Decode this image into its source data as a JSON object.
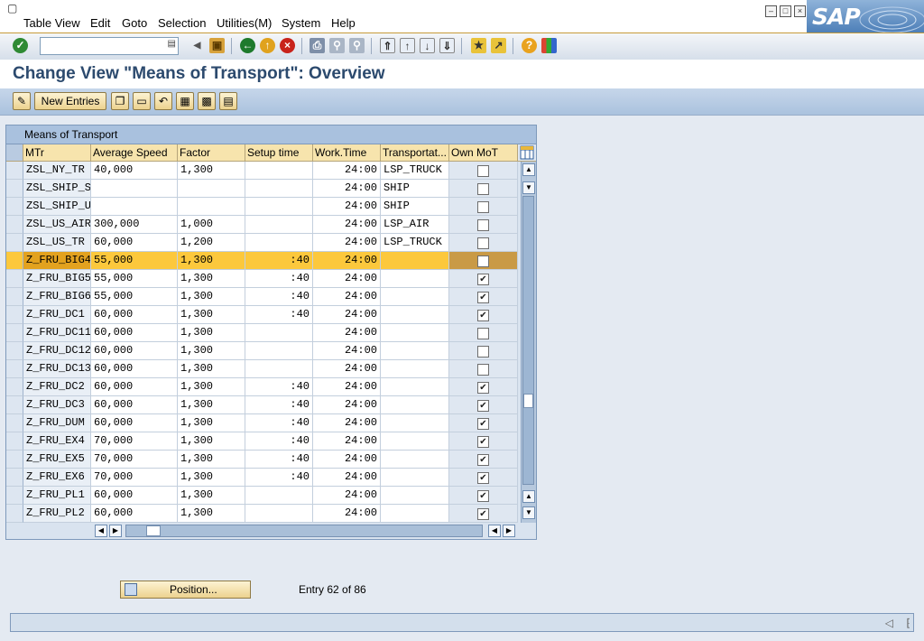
{
  "menubar": {
    "items": [
      {
        "label": "Table View"
      },
      {
        "label": "Edit"
      },
      {
        "label": "Goto"
      },
      {
        "label": "Selection"
      },
      {
        "label": "Utilities(M)"
      },
      {
        "label": "System"
      },
      {
        "label": "Help"
      }
    ],
    "logo": "SAP"
  },
  "toolbar": {
    "command_field": {
      "value": "",
      "placeholder": ""
    },
    "icons": [
      "enter-icon",
      "back-nav-icon",
      "save-icon",
      "back-icon",
      "exit-icon",
      "cancel-icon",
      "print-icon",
      "find-icon",
      "find-next-icon",
      "first-page-icon",
      "previous-page-icon",
      "next-page-icon",
      "last-page-icon",
      "create-session-icon",
      "shortcut-icon",
      "help-icon",
      "customize-layout-icon"
    ]
  },
  "page": {
    "title": "Change View \"Means of Transport\": Overview"
  },
  "app_toolbar": {
    "new_entries_label": "New Entries"
  },
  "table": {
    "title": "Means of Transport",
    "columns": [
      "MTr",
      "Average Speed",
      "Factor",
      "Setup time",
      "Work.Time",
      "Transportat...",
      "Own MoT"
    ],
    "rows": [
      {
        "mtr": "ZSL_NY_TR",
        "speed": "40,000",
        "factor": "1,300",
        "setup": "",
        "work": "24:00",
        "transp": "LSP_TRUCK",
        "own": false
      },
      {
        "mtr": "ZSL_SHIP_S",
        "speed": "",
        "factor": "",
        "setup": "",
        "work": "24:00",
        "transp": "SHIP",
        "own": false
      },
      {
        "mtr": "ZSL_SHIP_U",
        "speed": "",
        "factor": "",
        "setup": "",
        "work": "24:00",
        "transp": "SHIP",
        "own": false
      },
      {
        "mtr": "ZSL_US_AIR",
        "speed": "300,000",
        "factor": "1,000",
        "setup": "",
        "work": "24:00",
        "transp": "LSP_AIR",
        "own": false
      },
      {
        "mtr": "ZSL_US_TR",
        "speed": "60,000",
        "factor": "1,200",
        "setup": "",
        "work": "24:00",
        "transp": "LSP_TRUCK",
        "own": false
      },
      {
        "mtr": "Z_FRU_BIG4",
        "speed": "55,000",
        "factor": "1,300",
        "setup": ":40",
        "work": "24:00",
        "transp": "",
        "own": false,
        "highlighted": true
      },
      {
        "mtr": "Z_FRU_BIG5",
        "speed": "55,000",
        "factor": "1,300",
        "setup": ":40",
        "work": "24:00",
        "transp": "",
        "own": true
      },
      {
        "mtr": "Z_FRU_BIG6",
        "speed": "55,000",
        "factor": "1,300",
        "setup": ":40",
        "work": "24:00",
        "transp": "",
        "own": true
      },
      {
        "mtr": "Z_FRU_DC1",
        "speed": "60,000",
        "factor": "1,300",
        "setup": ":40",
        "work": "24:00",
        "transp": "",
        "own": true
      },
      {
        "mtr": "Z_FRU_DC11",
        "speed": "60,000",
        "factor": "1,300",
        "setup": "",
        "work": "24:00",
        "transp": "",
        "own": false
      },
      {
        "mtr": "Z_FRU_DC12",
        "speed": "60,000",
        "factor": "1,300",
        "setup": "",
        "work": "24:00",
        "transp": "",
        "own": false
      },
      {
        "mtr": "Z_FRU_DC13",
        "speed": "60,000",
        "factor": "1,300",
        "setup": "",
        "work": "24:00",
        "transp": "",
        "own": false
      },
      {
        "mtr": "Z_FRU_DC2",
        "speed": "60,000",
        "factor": "1,300",
        "setup": ":40",
        "work": "24:00",
        "transp": "",
        "own": true
      },
      {
        "mtr": "Z_FRU_DC3",
        "speed": "60,000",
        "factor": "1,300",
        "setup": ":40",
        "work": "24:00",
        "transp": "",
        "own": true
      },
      {
        "mtr": "Z_FRU_DUM",
        "speed": "60,000",
        "factor": "1,300",
        "setup": ":40",
        "work": "24:00",
        "transp": "",
        "own": true
      },
      {
        "mtr": "Z_FRU_EX4",
        "speed": "70,000",
        "factor": "1,300",
        "setup": ":40",
        "work": "24:00",
        "transp": "",
        "own": true
      },
      {
        "mtr": "Z_FRU_EX5",
        "speed": "70,000",
        "factor": "1,300",
        "setup": ":40",
        "work": "24:00",
        "transp": "",
        "own": true
      },
      {
        "mtr": "Z_FRU_EX6",
        "speed": "70,000",
        "factor": "1,300",
        "setup": ":40",
        "work": "24:00",
        "transp": "",
        "own": true
      },
      {
        "mtr": "Z_FRU_PL1",
        "speed": "60,000",
        "factor": "1,300",
        "setup": "",
        "work": "24:00",
        "transp": "",
        "own": true
      },
      {
        "mtr": "Z_FRU_PL2",
        "speed": "60,000",
        "factor": "1,300",
        "setup": "",
        "work": "24:00",
        "transp": "",
        "own": true
      }
    ]
  },
  "footer": {
    "position_label": "Position...",
    "entry_text": "Entry 62 of 86"
  },
  "colors": {
    "title_text": "#2c4a6e",
    "highlight_row": "#fcc83c",
    "button_face": "#ecd28f",
    "header_bg": "#f7e4ad"
  }
}
